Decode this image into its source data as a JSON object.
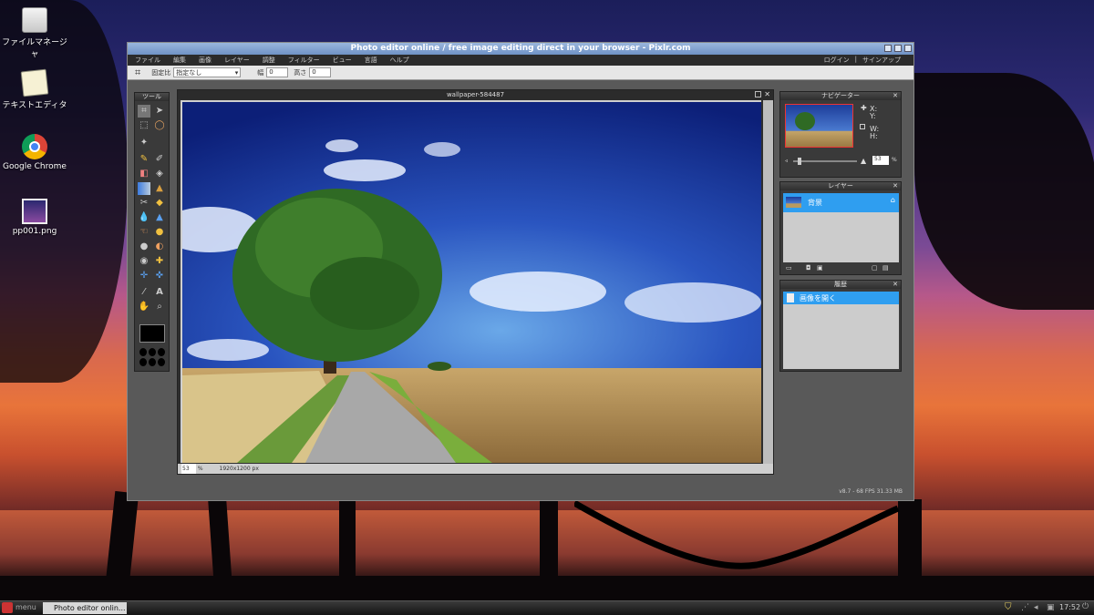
{
  "desktop": {
    "icons": [
      {
        "label": "ファイルマネージャ"
      },
      {
        "label": "テキストエディタ"
      },
      {
        "label": "Google Chrome"
      },
      {
        "label": "pp001.png"
      }
    ]
  },
  "window": {
    "title": "Photo editor online / free image editing direct in your browser - Pixlr.com"
  },
  "menu": {
    "items": [
      "ファイル",
      "編集",
      "画像",
      "レイヤー",
      "調整",
      "フィルター",
      "ビュー",
      "言語",
      "ヘルプ"
    ],
    "login": "ログイン",
    "signup": "サインアップ"
  },
  "options": {
    "constrain_label": "固定比",
    "constrain_value": "指定なし",
    "width_label": "幅",
    "width_value": "0",
    "height_label": "高さ",
    "height_value": "0"
  },
  "tools": {
    "title": "ツール"
  },
  "image": {
    "title": "wallpaper-584487",
    "zoom": "53",
    "zoom_unit": "%",
    "size": "1920x1200 px"
  },
  "navigator": {
    "title": "ナビゲーター",
    "x_label": "X:",
    "y_label": "Y:",
    "w_label": "W:",
    "h_label": "H:",
    "zoom": "53",
    "zoom_unit": "%"
  },
  "layers": {
    "title": "レイヤー",
    "items": [
      {
        "name": "背景"
      }
    ]
  },
  "history": {
    "title": "履歴",
    "items": [
      {
        "name": "画像を開く"
      }
    ]
  },
  "status": {
    "version": "v8.7 - 68 FPS 31.33 MB"
  },
  "taskbar": {
    "menu_label": "menu",
    "task_label": "Photo editor onlin...",
    "clock": "17:52"
  },
  "colors": {
    "title_blue": "#7a9ccd",
    "selected_blue": "#2f9ef0",
    "workspace": "#595959"
  }
}
